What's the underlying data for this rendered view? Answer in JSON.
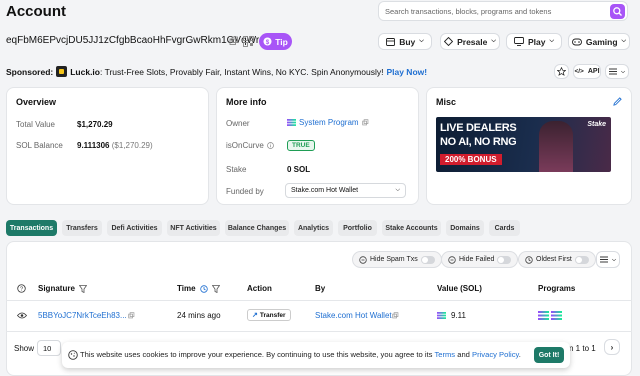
{
  "header": {
    "title": "Account",
    "search_placeholder": "Search transactions, blocks, programs and tokens",
    "address": "eqFbM6EPvcjDU5JJ1zCfgbBcaoHhFvgrGwRkm1GVqWr",
    "tip_label": "Tip",
    "nav": [
      {
        "label": "Buy"
      },
      {
        "label": "Presale"
      },
      {
        "label": "Play"
      },
      {
        "label": "Gaming"
      }
    ]
  },
  "sponsor": {
    "prefix": "Sponsored:",
    "brand": "Luck.io",
    "text": ": Trust-Free Slots, Provably Fair, Instant Wins, No KYC. Spin Anonymously!",
    "cta": "Play Now!",
    "api_label": "API"
  },
  "overview": {
    "heading": "Overview",
    "total_value_label": "Total Value",
    "total_value": "$1,270.29",
    "sol_balance_label": "SOL Balance",
    "sol_balance": "9.111306",
    "sol_balance_usd": "($1,270.29)"
  },
  "more_info": {
    "heading": "More info",
    "owner_label": "Owner",
    "owner_value": "System Program",
    "oncurve_label": "isOnCurve",
    "oncurve_value": "TRUE",
    "stake_label": "Stake",
    "stake_value": "0 SOL",
    "funded_label": "Funded by",
    "funded_value": "Stake.com Hot Wallet"
  },
  "misc": {
    "heading": "Misc",
    "ad_line1": "LIVE DEALERS",
    "ad_line2": "NO AI, NO RNG",
    "ad_line3": "200% BONUS",
    "ad_brand": "Stake"
  },
  "tabs": [
    {
      "label": "Transactions",
      "active": true
    },
    {
      "label": "Transfers"
    },
    {
      "label": "Defi Activities"
    },
    {
      "label": "NFT Activities"
    },
    {
      "label": "Balance Changes"
    },
    {
      "label": "Analytics"
    },
    {
      "label": "Portfolio"
    },
    {
      "label": "Stake Accounts"
    },
    {
      "label": "Domains"
    },
    {
      "label": "Cards"
    }
  ],
  "filters": {
    "hide_spam": "Hide Spam Txs",
    "hide_failed": "Hide Failed",
    "oldest_first": "Oldest First"
  },
  "table": {
    "columns": {
      "signature": "Signature",
      "time": "Time",
      "action": "Action",
      "by": "By",
      "value": "Value (SOL)",
      "programs": "Programs"
    },
    "rows": [
      {
        "signature": "5BBYoJC7NrkTceEh83...",
        "time": "24 mins ago",
        "action": "Transfer",
        "by": "Stake.com Hot Wallet",
        "value": "9.11"
      }
    ]
  },
  "footer": {
    "show_label": "Show",
    "page_size": "10",
    "pagination": "n 1 to 1"
  },
  "cookie": {
    "text": "This website uses cookies to improve your experience. By continuing to use this website, you agree to its",
    "terms": "Terms",
    "and": "and",
    "privacy": "Privacy Policy",
    "period": ".",
    "button": "Got It!"
  },
  "colors": {
    "accent": "#1e7a68",
    "link": "#1f6fd1",
    "tip": "#a855f7",
    "search_button": "#a855f7",
    "true_badge": "#1f9d55"
  }
}
